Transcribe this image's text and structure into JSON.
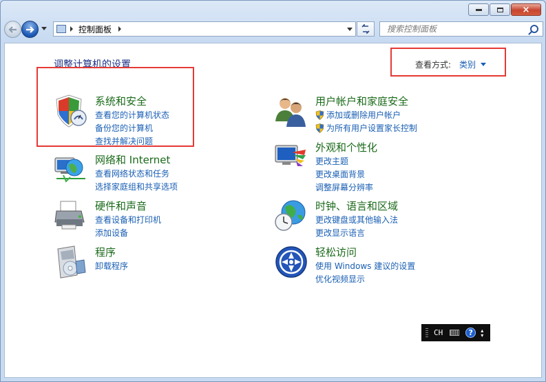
{
  "window": {
    "caption": {
      "minimize": "minimize",
      "maximize": "maximize",
      "close": "×"
    }
  },
  "navbar": {
    "breadcrumb": "控制面板",
    "search_placeholder": "搜索控制面板"
  },
  "content": {
    "heading": "调整计算机的设置",
    "view_by_label": "查看方式:",
    "view_by_value": "类别"
  },
  "categories": {
    "system_security": {
      "title": "系统和安全",
      "links": [
        "查看您的计算机状态",
        "备份您的计算机",
        "查找并解决问题"
      ]
    },
    "network": {
      "title": "网络和 Internet",
      "links": [
        "查看网络状态和任务",
        "选择家庭组和共享选项"
      ]
    },
    "hardware": {
      "title": "硬件和声音",
      "links": [
        "查看设备和打印机",
        "添加设备"
      ]
    },
    "programs": {
      "title": "程序",
      "links": [
        "卸载程序"
      ]
    },
    "user_accounts": {
      "title": "用户帐户和家庭安全",
      "links": [
        "添加或删除用户帐户",
        "为所有用户设置家长控制"
      ]
    },
    "appearance": {
      "title": "外观和个性化",
      "links": [
        "更改主题",
        "更改桌面背景",
        "调整屏幕分辨率"
      ]
    },
    "clock_region": {
      "title": "时钟、语言和区域",
      "links": [
        "更改键盘或其他输入法",
        "更改显示语言"
      ]
    },
    "ease_access": {
      "title": "轻松访问",
      "links": [
        "使用 Windows 建议的设置",
        "优化视频显示"
      ]
    }
  },
  "langbar": {
    "ime": "CH",
    "help": "?"
  },
  "colors": {
    "category_title": "#1a6a1a",
    "link": "#1a5fb4",
    "highlight_box": "#e53935"
  }
}
